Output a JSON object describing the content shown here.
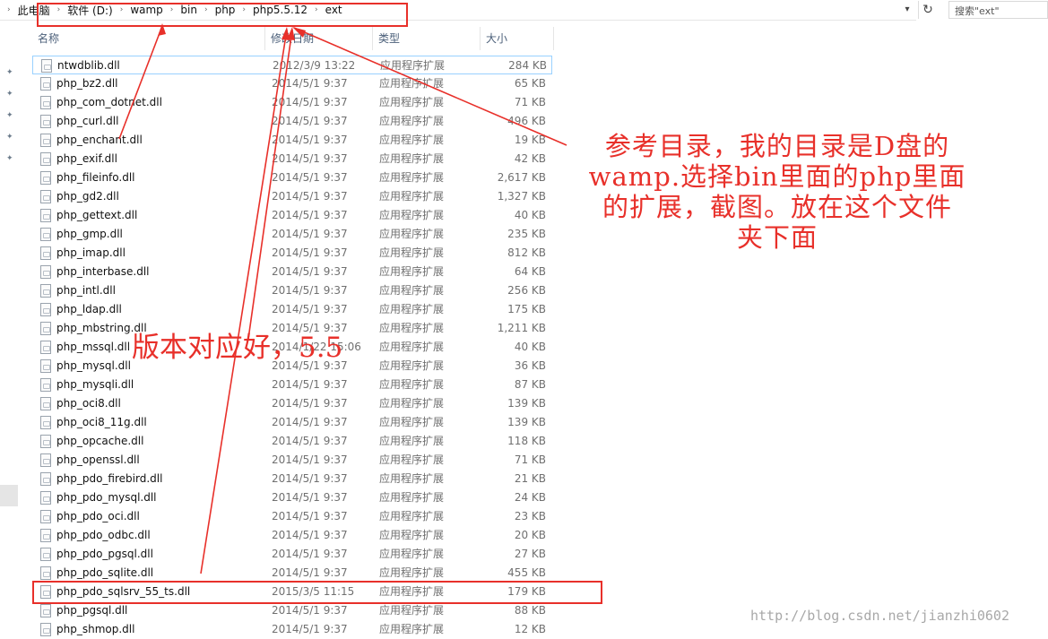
{
  "address_bar": {
    "breadcrumb": [
      "此电脑",
      "软件 (D:)",
      "wamp",
      "bin",
      "php",
      "php5.5.12",
      "ext"
    ],
    "search_placeholder": "搜索\"ext\""
  },
  "columns": {
    "name": "名称",
    "date": "修改日期",
    "type": "类型",
    "size": "大小"
  },
  "files": [
    {
      "name": "ntwdblib.dll",
      "date": "2012/3/9 13:22",
      "type": "应用程序扩展",
      "size": "284 KB"
    },
    {
      "name": "php_bz2.dll",
      "date": "2014/5/1 9:37",
      "type": "应用程序扩展",
      "size": "65 KB"
    },
    {
      "name": "php_com_dotnet.dll",
      "date": "2014/5/1 9:37",
      "type": "应用程序扩展",
      "size": "71 KB"
    },
    {
      "name": "php_curl.dll",
      "date": "2014/5/1 9:37",
      "type": "应用程序扩展",
      "size": "496 KB"
    },
    {
      "name": "php_enchant.dll",
      "date": "2014/5/1 9:37",
      "type": "应用程序扩展",
      "size": "19 KB"
    },
    {
      "name": "php_exif.dll",
      "date": "2014/5/1 9:37",
      "type": "应用程序扩展",
      "size": "42 KB"
    },
    {
      "name": "php_fileinfo.dll",
      "date": "2014/5/1 9:37",
      "type": "应用程序扩展",
      "size": "2,617 KB"
    },
    {
      "name": "php_gd2.dll",
      "date": "2014/5/1 9:37",
      "type": "应用程序扩展",
      "size": "1,327 KB"
    },
    {
      "name": "php_gettext.dll",
      "date": "2014/5/1 9:37",
      "type": "应用程序扩展",
      "size": "40 KB"
    },
    {
      "name": "php_gmp.dll",
      "date": "2014/5/1 9:37",
      "type": "应用程序扩展",
      "size": "235 KB"
    },
    {
      "name": "php_imap.dll",
      "date": "2014/5/1 9:37",
      "type": "应用程序扩展",
      "size": "812 KB"
    },
    {
      "name": "php_interbase.dll",
      "date": "2014/5/1 9:37",
      "type": "应用程序扩展",
      "size": "64 KB"
    },
    {
      "name": "php_intl.dll",
      "date": "2014/5/1 9:37",
      "type": "应用程序扩展",
      "size": "256 KB"
    },
    {
      "name": "php_ldap.dll",
      "date": "2014/5/1 9:37",
      "type": "应用程序扩展",
      "size": "175 KB"
    },
    {
      "name": "php_mbstring.dll",
      "date": "2014/5/1 9:37",
      "type": "应用程序扩展",
      "size": "1,211 KB"
    },
    {
      "name": "php_mssql.dll",
      "date": "2014/1/22 15:06",
      "type": "应用程序扩展",
      "size": "40 KB"
    },
    {
      "name": "php_mysql.dll",
      "date": "2014/5/1 9:37",
      "type": "应用程序扩展",
      "size": "36 KB"
    },
    {
      "name": "php_mysqli.dll",
      "date": "2014/5/1 9:37",
      "type": "应用程序扩展",
      "size": "87 KB"
    },
    {
      "name": "php_oci8.dll",
      "date": "2014/5/1 9:37",
      "type": "应用程序扩展",
      "size": "139 KB"
    },
    {
      "name": "php_oci8_11g.dll",
      "date": "2014/5/1 9:37",
      "type": "应用程序扩展",
      "size": "139 KB"
    },
    {
      "name": "php_opcache.dll",
      "date": "2014/5/1 9:37",
      "type": "应用程序扩展",
      "size": "118 KB"
    },
    {
      "name": "php_openssl.dll",
      "date": "2014/5/1 9:37",
      "type": "应用程序扩展",
      "size": "71 KB"
    },
    {
      "name": "php_pdo_firebird.dll",
      "date": "2014/5/1 9:37",
      "type": "应用程序扩展",
      "size": "21 KB"
    },
    {
      "name": "php_pdo_mysql.dll",
      "date": "2014/5/1 9:37",
      "type": "应用程序扩展",
      "size": "24 KB"
    },
    {
      "name": "php_pdo_oci.dll",
      "date": "2014/5/1 9:37",
      "type": "应用程序扩展",
      "size": "23 KB"
    },
    {
      "name": "php_pdo_odbc.dll",
      "date": "2014/5/1 9:37",
      "type": "应用程序扩展",
      "size": "20 KB"
    },
    {
      "name": "php_pdo_pgsql.dll",
      "date": "2014/5/1 9:37",
      "type": "应用程序扩展",
      "size": "27 KB"
    },
    {
      "name": "php_pdo_sqlite.dll",
      "date": "2014/5/1 9:37",
      "type": "应用程序扩展",
      "size": "455 KB"
    },
    {
      "name": "php_pdo_sqlsrv_55_ts.dll",
      "date": "2015/3/5 11:15",
      "type": "应用程序扩展",
      "size": "179 KB"
    },
    {
      "name": "php_pgsql.dll",
      "date": "2014/5/1 9:37",
      "type": "应用程序扩展",
      "size": "88 KB"
    },
    {
      "name": "php_shmop.dll",
      "date": "2014/5/1 9:37",
      "type": "应用程序扩展",
      "size": "12 KB"
    }
  ],
  "annotations": {
    "note_path": [
      "参考目录，我的目录是D盘的",
      "wamp.选择bin里面的php里面",
      "的扩展，截图。放在这个文件",
      "夹下面"
    ],
    "note_version": "版本对应好，5.5"
  },
  "watermark": "http://blog.csdn.net/jianzhi0602",
  "colors": {
    "annotation": "#e8302a",
    "header_text": "#4c607a",
    "selection_border": "#99d1ff"
  }
}
